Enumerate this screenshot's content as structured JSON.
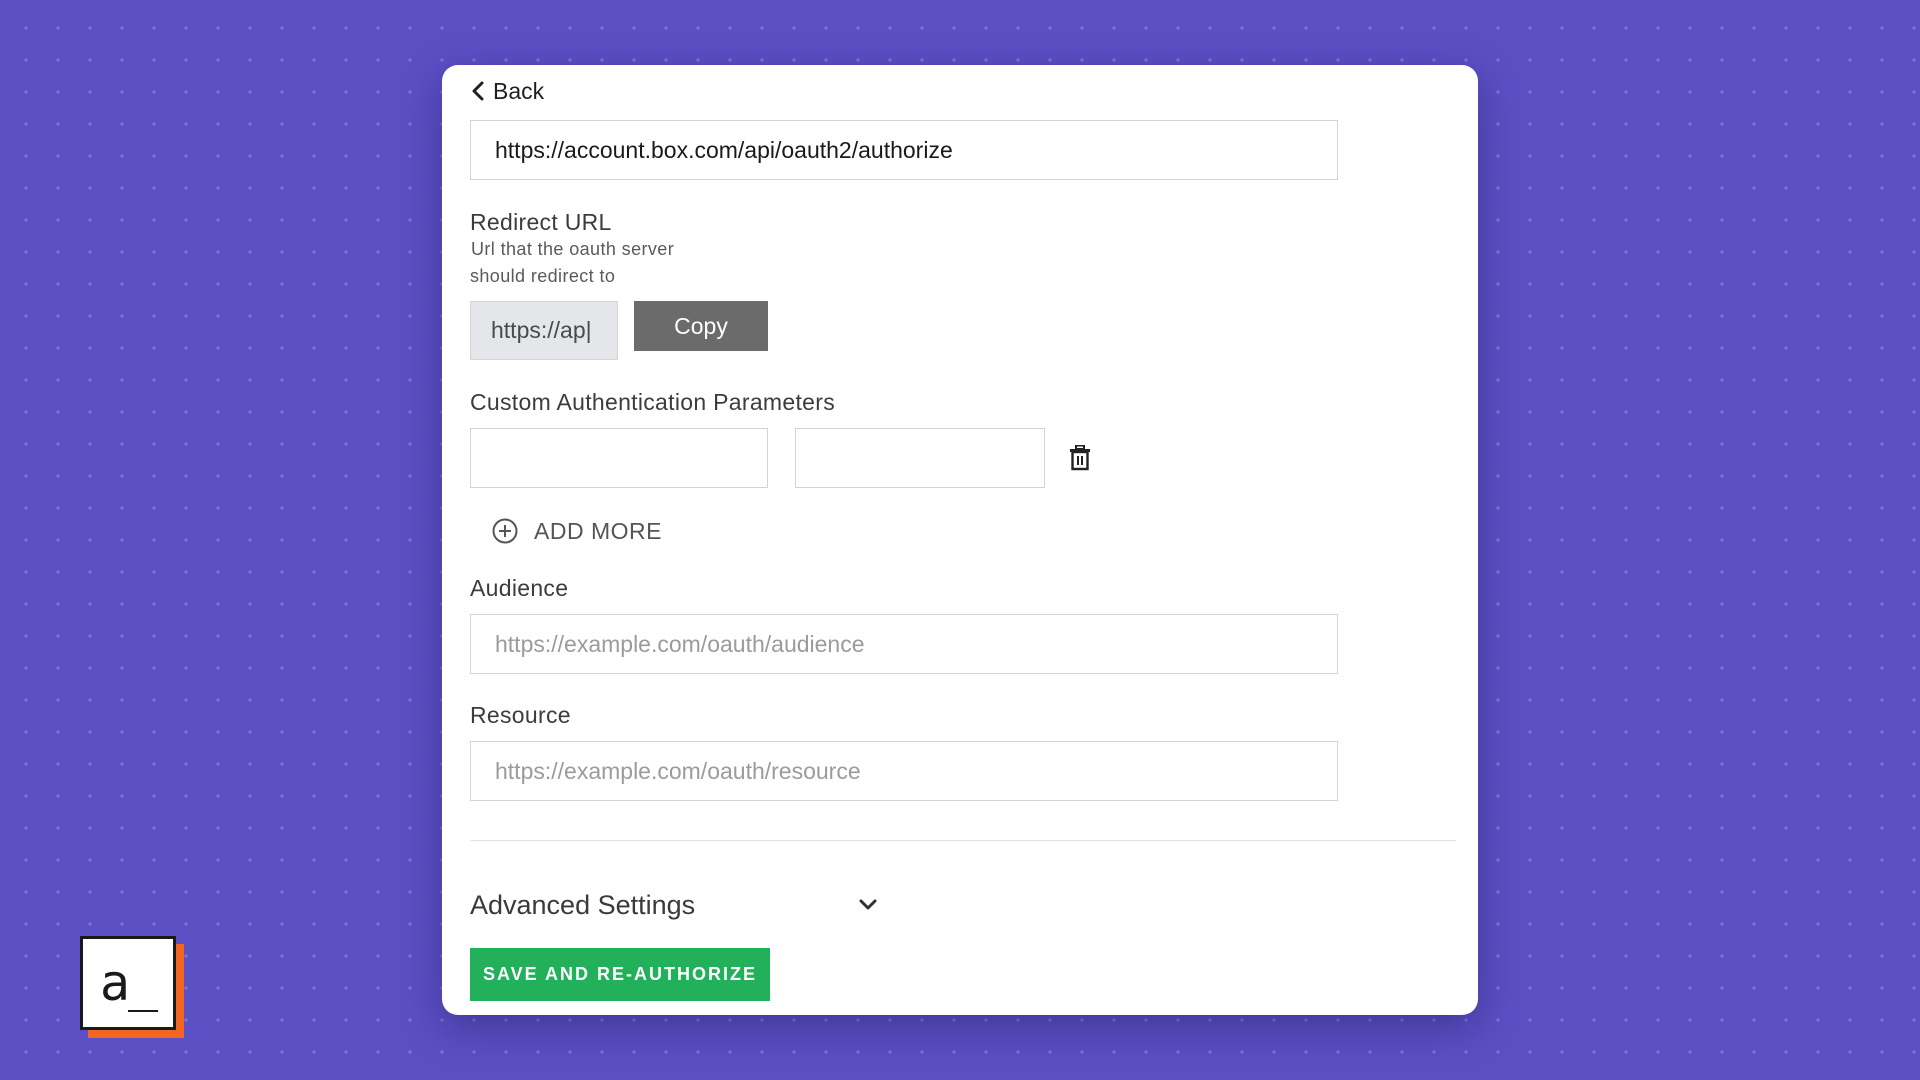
{
  "form": {
    "back_label": "Back",
    "auth_url_value": "https://account.box.com/api/oauth2/authorize",
    "redirect": {
      "label": "Redirect URL",
      "help_line1": "Url that the oauth server",
      "help_line2": "should redirect to",
      "value": "https://ap|",
      "copy_label": "Copy"
    },
    "custom_params": {
      "label": "Custom Authentication Parameters",
      "key_value": "",
      "value_value": "",
      "add_more_label": "ADD MORE"
    },
    "audience": {
      "label": "Audience",
      "placeholder": "https://example.com/oauth/audience"
    },
    "resource": {
      "label": "Resource",
      "placeholder": "https://example.com/oauth/resource"
    },
    "advanced_label": "Advanced Settings",
    "save_label": "SAVE AND RE-AUTHORIZE"
  },
  "brand": {
    "logo_text": "a_",
    "accent_color": "#f26522",
    "save_color": "#23b05a",
    "background_color": "#5b4fc4"
  },
  "icons": {
    "back": "chevron-left-icon",
    "delete": "trash-icon",
    "add": "plus-circle-icon",
    "expand": "chevron-down-icon"
  }
}
